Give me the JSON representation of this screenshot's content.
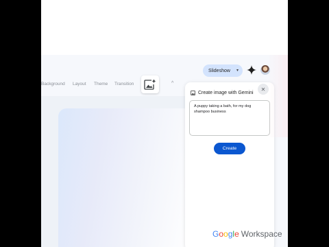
{
  "topbar": {
    "slideshow_label": "Slideshow",
    "slideshow_caret": "▾",
    "spark_icon": "gemini-spark-icon",
    "avatar_icon": "user-avatar"
  },
  "toolbar": {
    "items": [
      "Background",
      "Layout",
      "Theme",
      "Transition"
    ],
    "chevron": "^"
  },
  "panel": {
    "title": "Create image with Gemini",
    "close_glyph": "✕",
    "prompt_value": "A puppy taking a bath, for my dog shampoo business",
    "create_label": "Create"
  },
  "branding": {
    "google_letters": [
      "G",
      "o",
      "o",
      "g",
      "l",
      "e"
    ],
    "google_colors": [
      "#4285F4",
      "#EA4335",
      "#FBBC05",
      "#4285F4",
      "#34A853",
      "#EA4335"
    ],
    "product": "Workspace"
  },
  "colors": {
    "accent": "#0b57d0",
    "slideshow_bg": "#d3e3fd"
  }
}
